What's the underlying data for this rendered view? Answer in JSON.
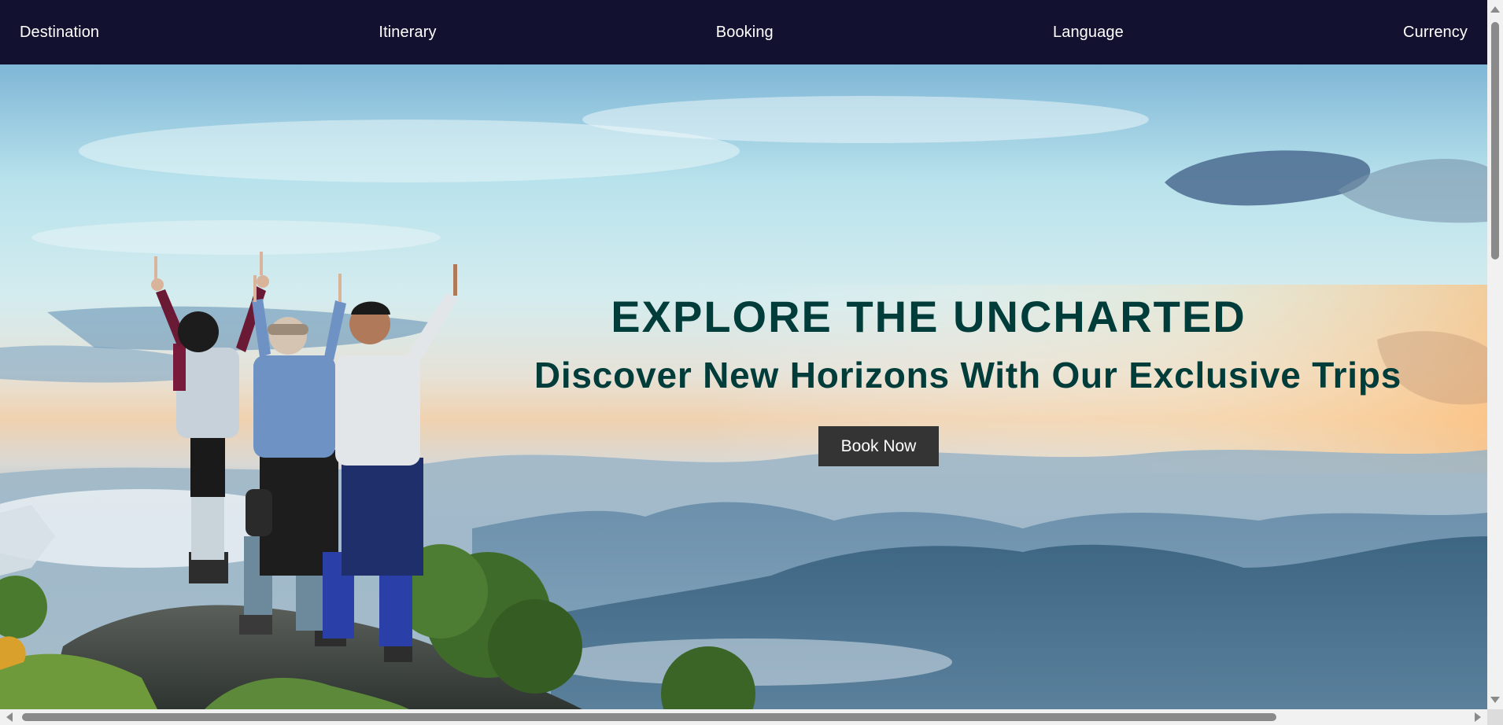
{
  "nav": {
    "items": [
      {
        "label": "Destination"
      },
      {
        "label": "Itinerary"
      },
      {
        "label": "Booking"
      },
      {
        "label": "Language"
      },
      {
        "label": "Currency"
      }
    ]
  },
  "hero": {
    "title": "EXPLORE THE UNCHARTED",
    "subtitle": "Discover New Horizons With Our Exclusive Trips",
    "cta_label": "Book Now",
    "image_description_icon": "mountain-hikers-photo"
  },
  "colors": {
    "nav_background": "#12112f",
    "heading_text": "#003d3a",
    "cta_background": "#343434"
  }
}
